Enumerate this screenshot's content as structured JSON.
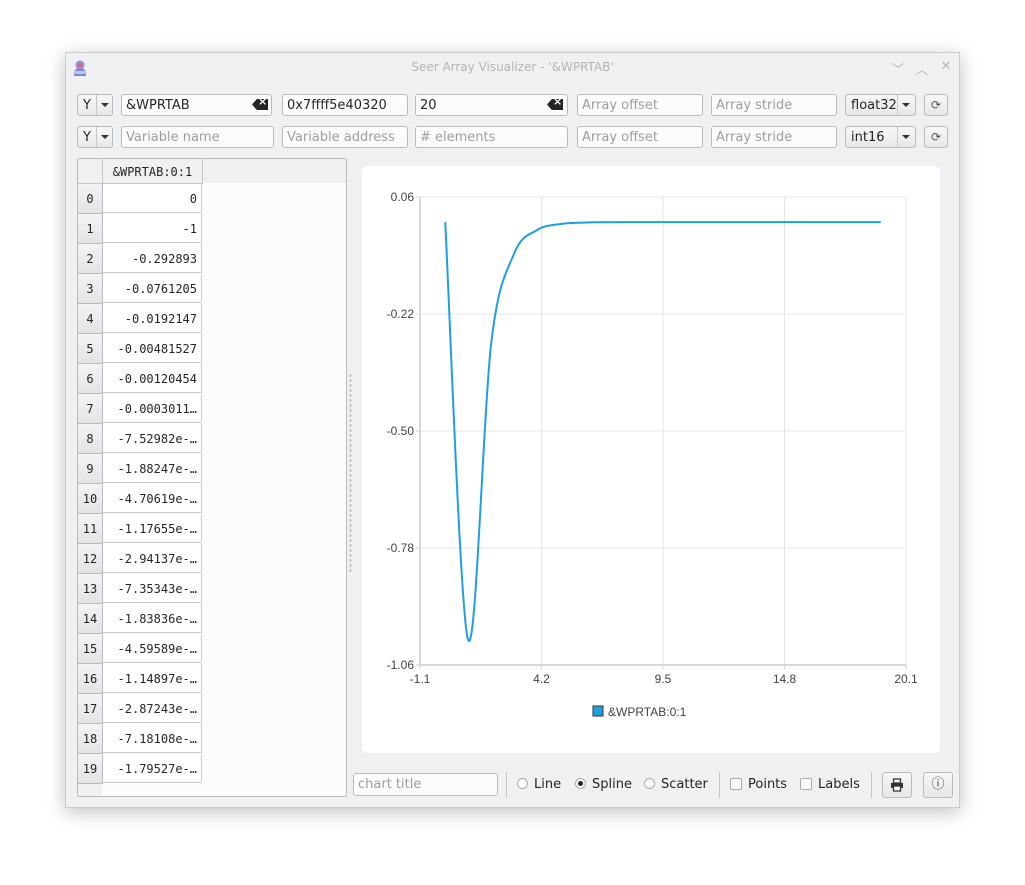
{
  "window": {
    "title": "Seer Array Visualizer - '&WPRTAB'",
    "controls": [
      "minimize",
      "maximize",
      "close"
    ]
  },
  "rows": [
    {
      "axis": "Y",
      "variable_name": "&WPRTAB",
      "variable_name_placeholder": "Variable name",
      "variable_address": "0x7ffff5e40320",
      "variable_address_placeholder": "Variable address",
      "elements": "20",
      "elements_placeholder": "# elements",
      "offset": "",
      "offset_placeholder": "Array offset",
      "stride": "",
      "stride_placeholder": "Array stride",
      "dtype": "float32"
    },
    {
      "axis": "Y",
      "variable_name": "",
      "variable_name_placeholder": "Variable name",
      "variable_address": "",
      "variable_address_placeholder": "Variable address",
      "elements": "",
      "elements_placeholder": "# elements",
      "offset": "",
      "offset_placeholder": "Array offset",
      "stride": "",
      "stride_placeholder": "Array stride",
      "dtype": "int16"
    }
  ],
  "table": {
    "column_header": "&WPRTAB:0:1",
    "rows": [
      {
        "index": "0",
        "value": "0"
      },
      {
        "index": "1",
        "value": "-1"
      },
      {
        "index": "2",
        "value": "-0.292893"
      },
      {
        "index": "3",
        "value": "-0.0761205"
      },
      {
        "index": "4",
        "value": "-0.0192147"
      },
      {
        "index": "5",
        "value": "-0.00481527"
      },
      {
        "index": "6",
        "value": "-0.00120454"
      },
      {
        "index": "7",
        "value": "-0.0003011…"
      },
      {
        "index": "8",
        "value": "-7.52982e-…"
      },
      {
        "index": "9",
        "value": "-1.88247e-…"
      },
      {
        "index": "10",
        "value": "-4.70619e-…"
      },
      {
        "index": "11",
        "value": "-1.17655e-…"
      },
      {
        "index": "12",
        "value": "-2.94137e-…"
      },
      {
        "index": "13",
        "value": "-7.35343e-…"
      },
      {
        "index": "14",
        "value": "-1.83836e-…"
      },
      {
        "index": "15",
        "value": "-4.59589e-…"
      },
      {
        "index": "16",
        "value": "-1.14897e-…"
      },
      {
        "index": "17",
        "value": "-2.87243e-…"
      },
      {
        "index": "18",
        "value": "-7.18108e-…"
      },
      {
        "index": "19",
        "value": "-1.79527e-…"
      }
    ]
  },
  "chart_data": {
    "type": "line",
    "style": "spline",
    "title": "",
    "xlabel": "",
    "ylabel": "",
    "xlim": [
      -1.1,
      20.1
    ],
    "ylim": [
      -1.06,
      0.06
    ],
    "x_ticks": [
      "-1.1",
      "4.2",
      "9.5",
      "14.8",
      "20.1"
    ],
    "y_ticks": [
      "0.06",
      "-0.22",
      "-0.50",
      "-0.78",
      "-1.06"
    ],
    "grid": true,
    "legend_position": "bottom",
    "series": [
      {
        "name": "&WPRTAB:0:1",
        "color": "#209fdf",
        "x": [
          0,
          1,
          2,
          3,
          4,
          5,
          6,
          7,
          8,
          9,
          10,
          11,
          12,
          13,
          14,
          15,
          16,
          17,
          18,
          19
        ],
        "values": [
          0,
          -1,
          -0.292893,
          -0.0761205,
          -0.0192147,
          -0.00481527,
          -0.00120454,
          -0.0003011,
          -7.53e-05,
          -1.88e-05,
          -4.7e-06,
          -1.2e-06,
          -3e-07,
          -1e-07,
          0,
          0,
          0,
          0,
          0,
          0
        ]
      }
    ]
  },
  "toolbar": {
    "chart_title_placeholder": "chart title",
    "chart_title": "",
    "modes": [
      {
        "label": "Line",
        "selected": false
      },
      {
        "label": "Spline",
        "selected": true
      },
      {
        "label": "Scatter",
        "selected": false
      }
    ],
    "options": [
      {
        "label": "Points",
        "checked": false
      },
      {
        "label": "Labels",
        "checked": false
      }
    ],
    "print_icon": "printer-icon",
    "info_icon": "info-icon"
  }
}
